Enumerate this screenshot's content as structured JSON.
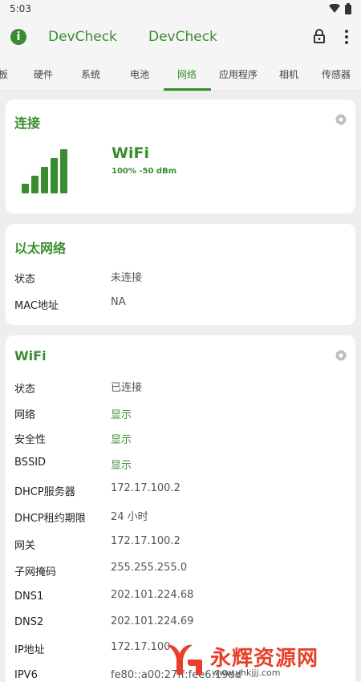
{
  "status_bar": {
    "time": "5:03",
    "wifi_icon": "wifi-icon",
    "battery_icon": "battery-icon"
  },
  "app_bar": {
    "title_left": "DevCheck",
    "title_right": "DevCheck",
    "info_icon": "info-icon",
    "lock_icon": "lock-icon",
    "more_icon": "more-vert-icon"
  },
  "tabs": [
    {
      "label": "板"
    },
    {
      "label": "硬件"
    },
    {
      "label": "系统"
    },
    {
      "label": "电池"
    },
    {
      "label": "网络"
    },
    {
      "label": "应用程序"
    },
    {
      "label": "相机"
    },
    {
      "label": "传感器"
    }
  ],
  "active_tab": "网络",
  "connection_card": {
    "title": "连接",
    "network_type": "WiFi",
    "strength": "100%  -50 dBm",
    "signal_level": 5,
    "signal_max": 5
  },
  "ethernet_card": {
    "title": "以太网络",
    "rows": [
      {
        "label": "状态",
        "value": "未连接"
      },
      {
        "label": "MAC地址",
        "value": "NA"
      }
    ]
  },
  "wifi_card": {
    "title": "WiFi",
    "rows": [
      {
        "label": "状态",
        "value": "已连接"
      },
      {
        "label": "网络",
        "value": "显示"
      },
      {
        "label": "安全性",
        "value": "显示"
      },
      {
        "label": "BSSID",
        "value": "显示"
      },
      {
        "label": "DHCP服务器",
        "value": "172.17.100.2"
      },
      {
        "label": "DHCP租约期限",
        "value": "24 小时"
      },
      {
        "label": "网关",
        "value": "172.17.100.2"
      },
      {
        "label": "子网掩码",
        "value": "255.255.255.0"
      },
      {
        "label": "DNS1",
        "value": "202.101.224.68"
      },
      {
        "label": "DNS2",
        "value": "202.101.224.69"
      },
      {
        "label": "IP地址",
        "value": "172.17.100"
      },
      {
        "label": "IPV6",
        "value": "fe80::a00:27ff:fee6:19dd"
      }
    ]
  },
  "watermark": {
    "title": "永辉资源网",
    "url": "www.yhkjjj.com"
  },
  "colors": {
    "accent": "#3a8d2e",
    "background": "#eeeeee",
    "card": "#ffffff",
    "watermark": "#e8412a"
  }
}
